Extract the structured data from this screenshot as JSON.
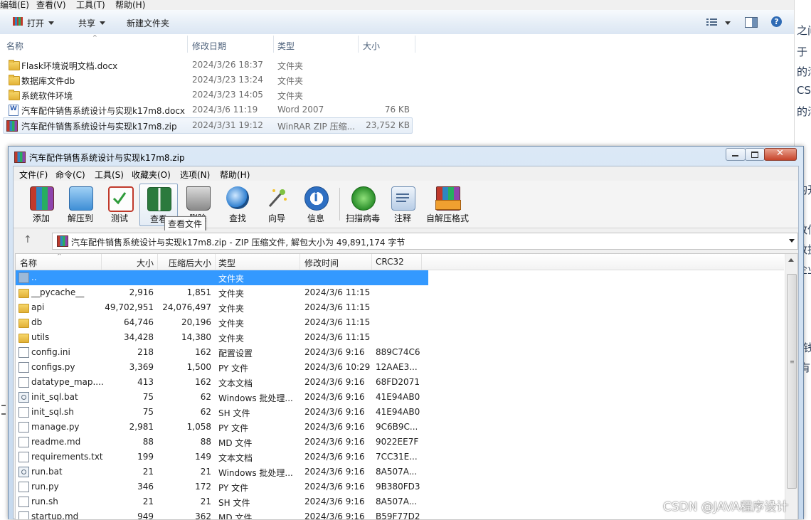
{
  "explorer": {
    "menu": [
      "编辑(E)",
      "查看(V)",
      "工具(T)",
      "帮助(H)"
    ],
    "toolbar": {
      "open": "打开",
      "share": "共享",
      "new_folder": "新建文件夹"
    },
    "columns": {
      "name": "名称",
      "date": "修改日期",
      "type": "类型",
      "size": "大小"
    },
    "files": [
      {
        "name": "Flask环境说明文档.docx",
        "date": "2024/3/26 18:37",
        "type": "文件夹",
        "size": "",
        "icon": "folder-icon"
      },
      {
        "name": "数据库文件db",
        "date": "2024/3/23 13:24",
        "type": "文件夹",
        "size": "",
        "icon": "folder-icon"
      },
      {
        "name": "系统软件环境",
        "date": "2024/3/23 14:05",
        "type": "文件夹",
        "size": "",
        "icon": "folder-icon"
      },
      {
        "name": "汽车配件销售系统设计与实现k17m8.docx",
        "date": "2024/3/6 11:19",
        "type": "Word 2007",
        "size": "76 KB",
        "icon": "word-doc-icon"
      },
      {
        "name": "汽车配件销售系统设计与实现k17m8.zip",
        "date": "2024/3/31 19:12",
        "type": "WinRAR ZIP 压缩...",
        "size": "23,752 KB",
        "icon": "winrar-icon"
      }
    ],
    "right_fragments": [
      "之间",
      "于 .",
      "的汽",
      "CS",
      "的汽",
      "的开",
      "数信",
      "数据",
      "企业",
      "a钱",
      "j有"
    ]
  },
  "rar": {
    "title": "汽车配件销售系统设计与实现k17m8.zip",
    "menu": [
      "文件(F)",
      "命令(C)",
      "工具(S)",
      "收藏夹(O)",
      "选项(N)",
      "帮助(H)"
    ],
    "toolbar": [
      "添加",
      "解压到",
      "测试",
      "查看",
      "删除",
      "查找",
      "向导",
      "信息",
      "扫描病毒",
      "注释",
      "自解压格式"
    ],
    "tooltip": "查看文件",
    "address": "汽车配件销售系统设计与实现k17m8.zip - ZIP 压缩文件, 解包大小为 49,891,174 字节",
    "columns": {
      "name": "名称",
      "size": "大小",
      "packed": "压缩后大小",
      "type": "类型",
      "mtime": "修改时间",
      "crc": "CRC32"
    },
    "files": [
      {
        "name": "..",
        "size": "",
        "packed": "",
        "type": "文件夹",
        "mtime": "",
        "crc": "",
        "kind": "up"
      },
      {
        "name": "__pycache__",
        "size": "2,916",
        "packed": "1,851",
        "type": "文件夹",
        "mtime": "2024/3/6 11:15",
        "crc": "",
        "kind": "folder"
      },
      {
        "name": "api",
        "size": "49,702,951",
        "packed": "24,076,497",
        "type": "文件夹",
        "mtime": "2024/3/6 11:15",
        "crc": "",
        "kind": "folder"
      },
      {
        "name": "db",
        "size": "64,746",
        "packed": "20,196",
        "type": "文件夹",
        "mtime": "2024/3/6 11:15",
        "crc": "",
        "kind": "folder"
      },
      {
        "name": "utils",
        "size": "34,428",
        "packed": "14,380",
        "type": "文件夹",
        "mtime": "2024/3/6 11:15",
        "crc": "",
        "kind": "folder"
      },
      {
        "name": "config.ini",
        "size": "218",
        "packed": "162",
        "type": "配置设置",
        "mtime": "2024/3/6 9:16",
        "crc": "889C74C6",
        "kind": "gear"
      },
      {
        "name": "configs.py",
        "size": "3,369",
        "packed": "1,500",
        "type": "PY 文件",
        "mtime": "2024/3/6 10:29",
        "crc": "12AAE3...",
        "kind": "file"
      },
      {
        "name": "datatype_map....",
        "size": "413",
        "packed": "162",
        "type": "文本文档",
        "mtime": "2024/3/6 9:16",
        "crc": "68FD2071",
        "kind": "file"
      },
      {
        "name": "init_sql.bat",
        "size": "75",
        "packed": "62",
        "type": "Windows 批处理...",
        "mtime": "2024/3/6 9:16",
        "crc": "41E94AB0",
        "kind": "bat"
      },
      {
        "name": "init_sql.sh",
        "size": "75",
        "packed": "62",
        "type": "SH 文件",
        "mtime": "2024/3/6 9:16",
        "crc": "41E94AB0",
        "kind": "file"
      },
      {
        "name": "manage.py",
        "size": "2,981",
        "packed": "1,058",
        "type": "PY 文件",
        "mtime": "2024/3/6 9:16",
        "crc": "9C6B9C...",
        "kind": "file"
      },
      {
        "name": "readme.md",
        "size": "88",
        "packed": "88",
        "type": "MD 文件",
        "mtime": "2024/3/6 9:16",
        "crc": "9022EE7F",
        "kind": "file"
      },
      {
        "name": "requirements.txt",
        "size": "199",
        "packed": "149",
        "type": "文本文档",
        "mtime": "2024/3/6 9:16",
        "crc": "7CC31E...",
        "kind": "file"
      },
      {
        "name": "run.bat",
        "size": "21",
        "packed": "21",
        "type": "Windows 批处理...",
        "mtime": "2024/3/6 9:16",
        "crc": "8A507A...",
        "kind": "bat"
      },
      {
        "name": "run.py",
        "size": "346",
        "packed": "172",
        "type": "PY 文件",
        "mtime": "2024/3/6 9:16",
        "crc": "9B380FD3",
        "kind": "file"
      },
      {
        "name": "run.sh",
        "size": "21",
        "packed": "21",
        "type": "SH 文件",
        "mtime": "2024/3/6 9:16",
        "crc": "8A507A...",
        "kind": "file"
      },
      {
        "name": "startup.md",
        "size": "949",
        "packed": "362",
        "type": "MD 文件",
        "mtime": "2024/3/6 9:16",
        "crc": "B59F77D2",
        "kind": "file"
      }
    ]
  },
  "watermark": "CSDN @JAVA程序设计"
}
